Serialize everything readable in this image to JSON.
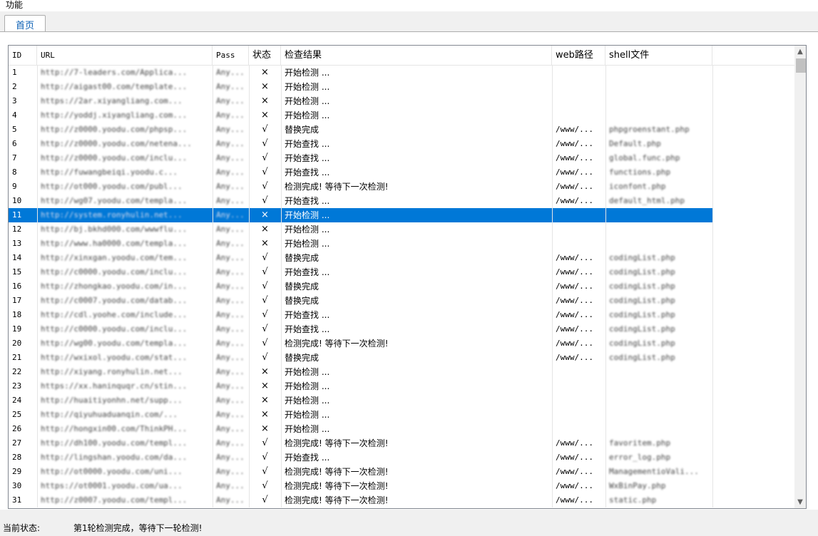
{
  "menu": {
    "function": "功能"
  },
  "tabs": [
    {
      "label": "首页"
    }
  ],
  "columns": {
    "id": "ID",
    "url": "URL",
    "pass": "Pass",
    "status": "状态",
    "result": "检查结果",
    "web": "web路径",
    "shell": "shell文件"
  },
  "rows": [
    {
      "id": "1",
      "url": "http://7-leaders.com/Applica...",
      "pass": "Any...",
      "status": "×",
      "result": "开始检测 ...",
      "web": "",
      "shell": ""
    },
    {
      "id": "2",
      "url": "http://aigast00.com/template...",
      "pass": "Any...",
      "status": "×",
      "result": "开始检测 ...",
      "web": "",
      "shell": ""
    },
    {
      "id": "3",
      "url": "https://2ar.xiyangliang.com...",
      "pass": "Any...",
      "status": "×",
      "result": "开始检测 ...",
      "web": "",
      "shell": ""
    },
    {
      "id": "4",
      "url": "http://yoddj.xiyangliang.com...",
      "pass": "Any...",
      "status": "×",
      "result": "开始检测 ...",
      "web": "",
      "shell": ""
    },
    {
      "id": "5",
      "url": "http://z0000.yoodu.com/phpsp...",
      "pass": "Any...",
      "status": "√",
      "result": "替换完成",
      "web": "/www/...",
      "shell": "phpgroenstant.php"
    },
    {
      "id": "6",
      "url": "http://z0000.yoodu.com/netena...",
      "pass": "Any...",
      "status": "√",
      "result": "开始查找 ...",
      "web": "/www/...",
      "shell": "Default.php"
    },
    {
      "id": "7",
      "url": "http://z0000.yoodu.com/inclu...",
      "pass": "Any...",
      "status": "√",
      "result": "开始查找 ...",
      "web": "/www/...",
      "shell": "global.func.php"
    },
    {
      "id": "8",
      "url": "http://fuwangbeiqi.yoodu.c...",
      "pass": "Any...",
      "status": "√",
      "result": "开始查找 ...",
      "web": "/www/...",
      "shell": "functions.php"
    },
    {
      "id": "9",
      "url": "http://ot000.yoodu.com/publ...",
      "pass": "Any...",
      "status": "√",
      "result": "检测完成! 等待下一次检测!",
      "web": "/www/...",
      "shell": "iconfont.php"
    },
    {
      "id": "10",
      "url": "http://wg07.yoodu.com/templa...",
      "pass": "Any...",
      "status": "√",
      "result": "开始查找 ...",
      "web": "/www/...",
      "shell": "default_html.php"
    },
    {
      "id": "11",
      "url": "http://system.ronyhulin.net...",
      "pass": "Any...",
      "status": "×",
      "result": "开始检测 ...",
      "web": "",
      "shell": "",
      "selected": true
    },
    {
      "id": "12",
      "url": "http://bj.bkhd000.com/wwwflu...",
      "pass": "Any...",
      "status": "×",
      "result": "开始检测 ...",
      "web": "",
      "shell": ""
    },
    {
      "id": "13",
      "url": "http://www.ha0000.com/templa...",
      "pass": "Any...",
      "status": "×",
      "result": "开始检测 ...",
      "web": "",
      "shell": ""
    },
    {
      "id": "14",
      "url": "http://xinxgan.yoodu.com/tem...",
      "pass": "Any...",
      "status": "√",
      "result": "替换完成",
      "web": "/www/...",
      "shell": "codingList.php"
    },
    {
      "id": "15",
      "url": "http://c0000.yoodu.com/inclu...",
      "pass": "Any...",
      "status": "√",
      "result": "开始查找 ...",
      "web": "/www/...",
      "shell": "codingList.php"
    },
    {
      "id": "16",
      "url": "http://zhongkao.yoodu.com/in...",
      "pass": "Any...",
      "status": "√",
      "result": "替换完成",
      "web": "/www/...",
      "shell": "codingList.php"
    },
    {
      "id": "17",
      "url": "http://c0007.yoodu.com/datab...",
      "pass": "Any...",
      "status": "√",
      "result": "替换完成",
      "web": "/www/...",
      "shell": "codingList.php"
    },
    {
      "id": "18",
      "url": "http://cdl.yoohe.com/include...",
      "pass": "Any...",
      "status": "√",
      "result": "开始查找 ...",
      "web": "/www/...",
      "shell": "codingList.php"
    },
    {
      "id": "19",
      "url": "http://c0000.yoodu.com/inclu...",
      "pass": "Any...",
      "status": "√",
      "result": "开始查找 ...",
      "web": "/www/...",
      "shell": "codingList.php"
    },
    {
      "id": "20",
      "url": "http://wg00.yoodu.com/templa...",
      "pass": "Any...",
      "status": "√",
      "result": "检测完成! 等待下一次检测!",
      "web": "/www/...",
      "shell": "codingList.php"
    },
    {
      "id": "21",
      "url": "http://wxixol.yoodu.com/stat...",
      "pass": "Any...",
      "status": "√",
      "result": "替换完成",
      "web": "/www/...",
      "shell": "codingList.php"
    },
    {
      "id": "22",
      "url": "http://xiyang.ronyhulin.net...",
      "pass": "Any...",
      "status": "×",
      "result": "开始检测 ...",
      "web": "",
      "shell": ""
    },
    {
      "id": "23",
      "url": "https://xx.haninquqr.cn/stin...",
      "pass": "Any...",
      "status": "×",
      "result": "开始检测 ...",
      "web": "",
      "shell": ""
    },
    {
      "id": "24",
      "url": "http://huaitiyonhn.net/supp...",
      "pass": "Any...",
      "status": "×",
      "result": "开始检测 ...",
      "web": "",
      "shell": ""
    },
    {
      "id": "25",
      "url": "http://qiyuhuaduanqin.com/...",
      "pass": "Any...",
      "status": "×",
      "result": "开始检测 ...",
      "web": "",
      "shell": ""
    },
    {
      "id": "26",
      "url": "http://hongxin00.com/ThinkPH...",
      "pass": "Any...",
      "status": "×",
      "result": "开始检测 ...",
      "web": "",
      "shell": ""
    },
    {
      "id": "27",
      "url": "http://dh100.yoodu.com/templ...",
      "pass": "Any...",
      "status": "√",
      "result": "检测完成! 等待下一次检测!",
      "web": "/www/...",
      "shell": "favoritem.php"
    },
    {
      "id": "28",
      "url": "http://lingshan.yoodu.com/da...",
      "pass": "Any...",
      "status": "√",
      "result": "开始查找 ...",
      "web": "/www/...",
      "shell": "error_log.php"
    },
    {
      "id": "29",
      "url": "http://ot0000.yoodu.com/uni...",
      "pass": "Any...",
      "status": "√",
      "result": "检测完成! 等待下一次检测!",
      "web": "/www/...",
      "shell": "ManagementioVali..."
    },
    {
      "id": "30",
      "url": "https://ot0001.yoodu.com/ua...",
      "pass": "Any...",
      "status": "√",
      "result": "检测完成! 等待下一次检测!",
      "web": "/www/...",
      "shell": "WxBinPay.php"
    },
    {
      "id": "31",
      "url": "http://z0007.yoodu.com/templ...",
      "pass": "Any...",
      "status": "√",
      "result": "检测完成! 等待下一次检测!",
      "web": "/www/...",
      "shell": "static.php"
    }
  ],
  "status": {
    "label": "当前状态:",
    "text": "第1轮检测完成，等待下一轮检测!"
  },
  "scrollbar": {
    "up": "▲",
    "down": "▼"
  }
}
